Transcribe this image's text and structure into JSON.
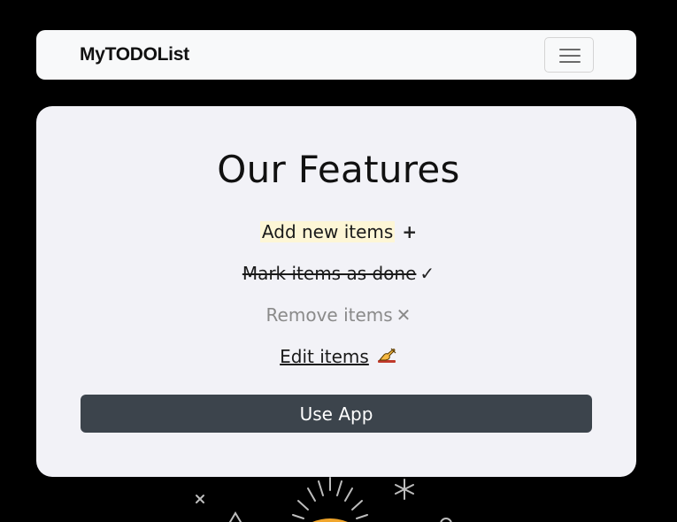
{
  "navbar": {
    "brand": "MyTODOList",
    "toggler_icon": "hamburger-menu-icon"
  },
  "features": {
    "title": "Our Features",
    "items": [
      {
        "label": "Add new items",
        "icon": "plus-icon",
        "glyph": "+"
      },
      {
        "label": "Mark items as done",
        "icon": "check-icon",
        "glyph": "✓"
      },
      {
        "label": "Remove items",
        "icon": "close-icon",
        "glyph": "✕"
      },
      {
        "label": "Edit items",
        "icon": "writing-hand-icon"
      }
    ],
    "cta_label": "Use App"
  },
  "colors": {
    "page_background": "#000000",
    "navbar_background": "#f8f9fa",
    "card_background": "#f2f2f7",
    "button_background": "#3c444c",
    "highlight": "#fdf6d6",
    "muted_text": "#8a8a8a"
  }
}
